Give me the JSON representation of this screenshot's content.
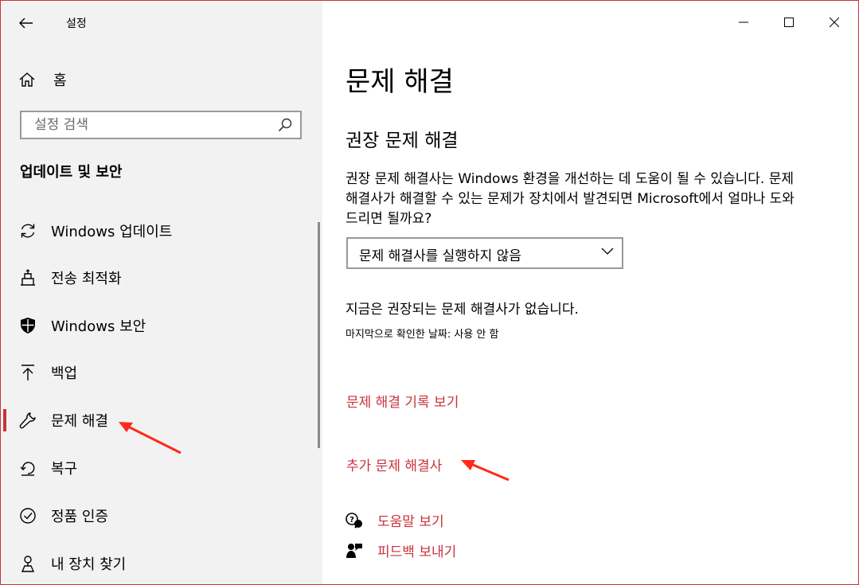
{
  "window": {
    "title": "설정",
    "controls": {
      "minimize": "minimize-icon",
      "maximize": "maximize-icon",
      "close": "close-icon"
    }
  },
  "sidebar": {
    "home_label": "홈",
    "search_placeholder": "설정 검색",
    "section_title": "업데이트 및 보안",
    "items": [
      {
        "label": "Windows 업데이트",
        "icon": "sync-icon"
      },
      {
        "label": "전송 최적화",
        "icon": "delivery-optimization-icon"
      },
      {
        "label": "Windows 보안",
        "icon": "shield-icon"
      },
      {
        "label": "백업",
        "icon": "backup-arrow-icon"
      },
      {
        "label": "문제 해결",
        "icon": "wrench-icon",
        "active": true
      },
      {
        "label": "복구",
        "icon": "recovery-icon"
      },
      {
        "label": "정품 인증",
        "icon": "check-circle-icon"
      },
      {
        "label": "내 장치 찾기",
        "icon": "find-device-icon"
      }
    ]
  },
  "main": {
    "page_title": "문제 해결",
    "subtitle": "권장 문제 해결",
    "description": "권장 문제 해결사는 Windows 환경을 개선하는 데 도움이 될 수 있습니다. 문제 해결사가 해결할 수 있는 문제가 장치에서 발견되면 Microsoft에서 얼마나 도와드리면 될까요?",
    "dropdown_value": "문제 해결사를 실행하지 않음",
    "status_text": "지금은 권장되는 문제 해결사가 없습니다.",
    "last_checked": "마지막으로 확인한 날짜: 사용 안 함",
    "history_link": "문제 해결 기록 보기",
    "additional_link": "추가 문제 해결사",
    "help_link": "도움말 보기",
    "feedback_link": "피드백 보내기"
  },
  "colors": {
    "accent": "#c8333b",
    "sidebar_bg": "#f2f2f2",
    "annotation_arrow": "#ff2a1a"
  }
}
